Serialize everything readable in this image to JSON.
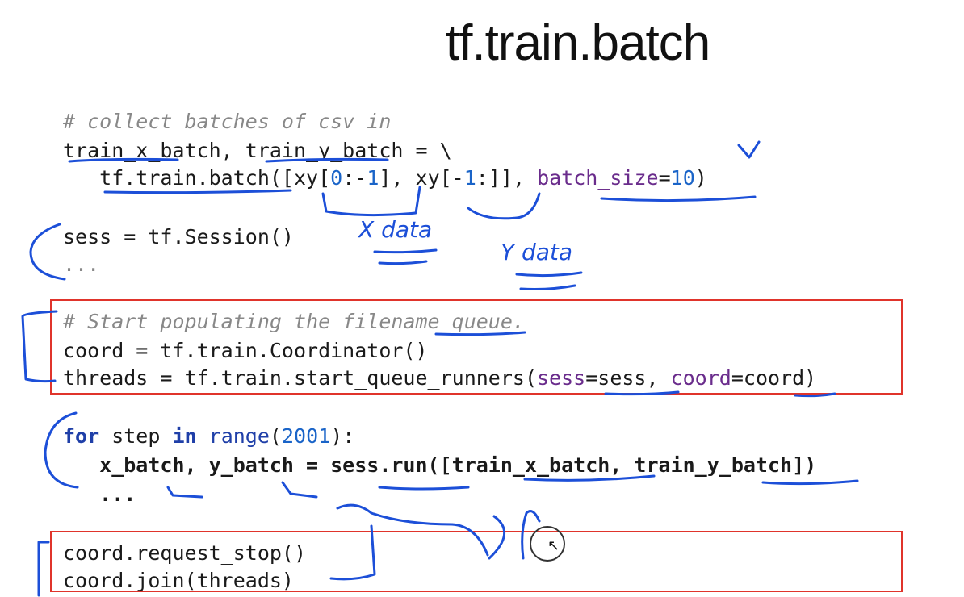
{
  "slide": {
    "title": "tf.train.batch"
  },
  "code": {
    "comment_collect": "# collect batches of csv in",
    "l2_a": "train_x_batch, train_y_batch = \\",
    "l3_a": "   tf.train.batch([xy[",
    "l3_n1": "0",
    "l3_b": ":-",
    "l3_n2": "1",
    "l3_c": "], xy[-",
    "l3_n3": "1",
    "l3_d": ":]], ",
    "l3_kw": "batch_size",
    "l3_eq": "=",
    "l3_n4": "10",
    "l3_e": ")",
    "sess": "sess = tf.Session()",
    "ellipsis1": "...",
    "comment_start": "# Start populating the filename queue.",
    "coord": "coord = tf.train.Coordinator()",
    "threads_a": "threads = tf.train.start_queue_runners(",
    "threads_kw1": "sess",
    "threads_b": "=sess, ",
    "threads_kw2": "coord",
    "threads_c": "=coord)",
    "for_kw": "for",
    "for_a": " step ",
    "in_kw": "in",
    "for_sp": " ",
    "range": "range",
    "for_p1": "(",
    "for_num": "2001",
    "for_p2": "):",
    "run_line": "   x_batch, y_batch = sess.run([train_x_batch, train_y_batch])",
    "ellipsis2": "   ...",
    "stop": "coord.request_stop()",
    "join": "coord.join(threads)"
  },
  "annotations": {
    "x_data": "X data",
    "y_data": "Y data"
  },
  "colors": {
    "ink": "#1c4fd8",
    "box": "#e0342b",
    "comment": "#888888",
    "number": "#1a64c8",
    "keyword": "#1f3fa8",
    "kwarg": "#6a2c8c"
  }
}
